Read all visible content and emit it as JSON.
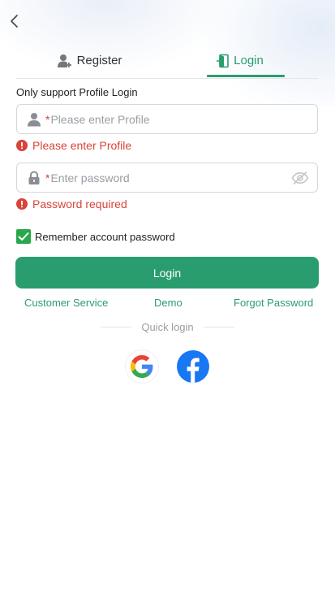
{
  "nav": {
    "back_icon": "chevron-left-icon"
  },
  "tabs": [
    {
      "label": "Register",
      "icon": "user-plus-icon",
      "active": false
    },
    {
      "label": "Login",
      "icon": "door-exit-icon",
      "active": true
    }
  ],
  "form": {
    "hint": "Only support Profile Login",
    "profile": {
      "required_mark": "*",
      "placeholder": "Please enter Profile",
      "value": "",
      "icon": "user-icon",
      "error": "Please enter Profile"
    },
    "password": {
      "required_mark": "*",
      "placeholder": "Enter password",
      "value": "",
      "icon": "lock-icon",
      "toggle_icon": "eye-off-icon",
      "error": "Password required"
    },
    "remember": {
      "label": "Remember account password",
      "checked": true
    },
    "submit_label": "Login"
  },
  "links": {
    "customer_service": "Customer Service",
    "demo": "Demo",
    "forgot_password": "Forgot Password"
  },
  "quick_login": {
    "label": "Quick login",
    "providers": [
      "google-icon",
      "facebook-icon"
    ]
  },
  "colors": {
    "accent": "#2a9d6e",
    "error": "#d9443a",
    "checkbox": "#2aa74a",
    "facebook": "#1877f2"
  }
}
